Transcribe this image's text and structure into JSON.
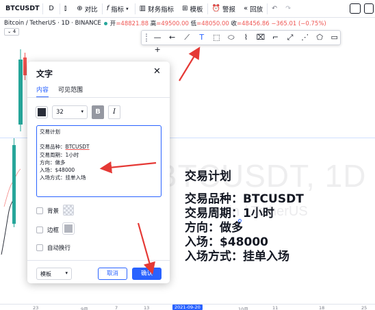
{
  "toolbar": {
    "symbol": "BTCUSDT",
    "interval": "D",
    "compare": "对比",
    "indicators": "指标",
    "financials": "财务指标",
    "templates": "模板",
    "alert": "警报",
    "replay": "回放"
  },
  "chart_header": {
    "pair": "Bitcoin / TetherUS · 1D · BINANCE",
    "open_label": "开",
    "open": "=48821.88",
    "high_label": "高",
    "high": "=49500.00",
    "low_label": "低",
    "low": "=48050.00",
    "close_label": "收",
    "close": "=48456.86 −365.01 (−0.75%)",
    "collapse": "⌄ 4"
  },
  "watermark": {
    "main": "BTCUSDT, 1D",
    "sub": "Bitcoin / TetherUS"
  },
  "chart_text": {
    "line1": "交易计划",
    "line2": "交易品种：BTCUSDT",
    "line3": "交易周期：1小时",
    "line4": "方向：做多",
    "line5": "入场：$48000",
    "line6": "入场方式：挂单入场"
  },
  "time_axis": [
    "23",
    "9月",
    "7",
    "13",
    "2021-09-20",
    "10月",
    "11",
    "18",
    "25"
  ],
  "dialog": {
    "title": "文字",
    "tab_content": "内容",
    "tab_visibility": "可见范围",
    "font_size": "32",
    "bold": "B",
    "italic": "I",
    "text_lines": [
      "交易计划",
      "",
      "交易品种：",
      "BTCUSDT",
      "交易周期：1小时",
      "方向：做多",
      "入场：$48000",
      "入场方式：挂单入场"
    ],
    "background_label": "背景",
    "border_label": "边框",
    "wrap_label": "自动换行",
    "template": "模板",
    "cancel": "取消",
    "ok": "确认"
  },
  "colors": {
    "accent": "#2962ff",
    "up": "#26a69a",
    "down": "#ef5350",
    "arrow": "#e53935"
  }
}
